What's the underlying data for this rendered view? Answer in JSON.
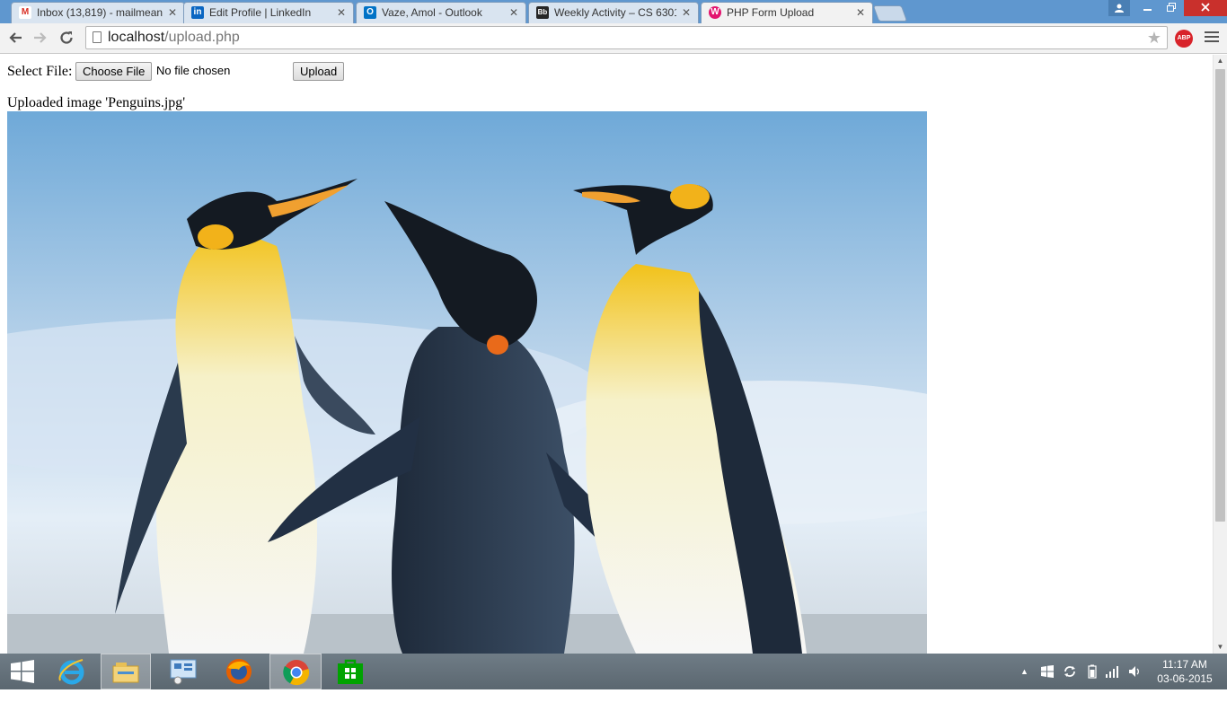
{
  "browser": {
    "tabs": [
      {
        "title": "Inbox (13,819) - mailmean",
        "icon": "gmail-icon",
        "active": false
      },
      {
        "title": "Edit Profile | LinkedIn",
        "icon": "linkedin-icon",
        "active": false
      },
      {
        "title": "Vaze, Amol - Outlook",
        "icon": "outlook-icon",
        "active": false
      },
      {
        "title": "Weekly Activity – CS 6301",
        "icon": "blackboard-icon",
        "active": false
      },
      {
        "title": "PHP Form Upload",
        "icon": "wamp-icon",
        "active": true
      }
    ],
    "url_host": "localhost",
    "url_path": "/upload.php",
    "extension_label": "ABP",
    "colors": {
      "tabstrip": "#5f97cf",
      "close_button": "#c9302c"
    }
  },
  "page": {
    "file_label": "Select File:",
    "choose_button": "Choose File",
    "file_status": "No file chosen",
    "upload_button": "Upload",
    "uploaded_message": "Uploaded image 'Penguins.jpg'"
  },
  "taskbar": {
    "apps": [
      "start-icon",
      "internet-explorer-icon",
      "file-explorer-icon",
      "control-panel-icon",
      "firefox-icon",
      "chrome-icon",
      "store-icon"
    ],
    "active_app": "chrome-icon",
    "time": "11:17 AM",
    "date": "03-06-2015"
  }
}
